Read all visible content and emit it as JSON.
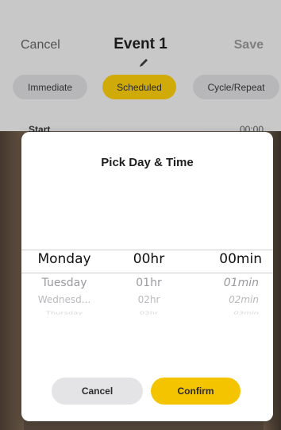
{
  "nav": {
    "cancel": "Cancel",
    "title": "Event 1",
    "save": "Save"
  },
  "icons": {
    "edit": "pencil-icon"
  },
  "mode_tabs": [
    {
      "label": "Immediate",
      "active": false
    },
    {
      "label": "Scheduled",
      "active": true
    },
    {
      "label": "Cycle/Repeat",
      "active": false
    }
  ],
  "start_row": {
    "label": "Start",
    "value": "00:00"
  },
  "dialog": {
    "title": "Pick Day & Time",
    "day_options": [
      "Monday",
      "Tuesday",
      "Wednesd...",
      "Thursday"
    ],
    "hour_options": [
      "00hr",
      "01hr",
      "02hr",
      "03hr"
    ],
    "minute_options": [
      "00min",
      "01min",
      "02min",
      "03min"
    ],
    "selected": {
      "day": "Monday",
      "hour": "00hr",
      "minute": "00min"
    },
    "cancel_label": "Cancel",
    "confirm_label": "Confirm"
  },
  "colors": {
    "accent_yellow": "#f5c400",
    "tab_active": "#e2b90a",
    "tab_inactive": "#c7c7c9"
  }
}
